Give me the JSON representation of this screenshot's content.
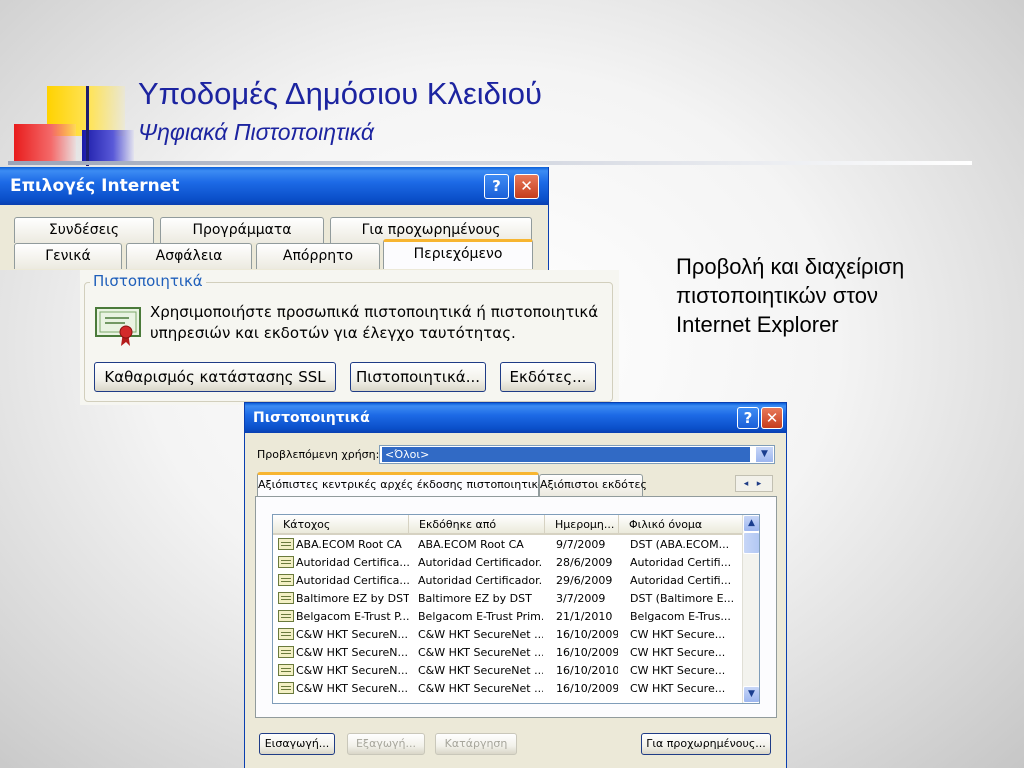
{
  "slide": {
    "title": "Υποδομές Δημόσιου Κλειδιού",
    "subtitle": "Ψηφιακά Πιστοποιητικά",
    "body_lines": [
      "Προβολή και διαχείριση",
      "πιστοποιητικών στον",
      "Internet Explorer"
    ]
  },
  "internet_options": {
    "title": "Επιλογές Internet",
    "help_glyph": "?",
    "close_glyph": "✕",
    "tabs_row1": [
      "Συνδέσεις",
      "Προγράμματα",
      "Για προχωρημένους"
    ],
    "tabs_row2": [
      "Γενικά",
      "Ασφάλεια",
      "Απόρρητο",
      "Περιεχόμενο"
    ],
    "active_tab": "Περιεχόμενο",
    "group_label": "Πιστοποιητικά",
    "description_lines": [
      "Χρησιμοποιήστε προσωπικά πιστοποιητικά ή πιστοποιητικά",
      "υπηρεσιών και εκδοτών για έλεγχο ταυτότητας."
    ],
    "buttons": {
      "clear_ssl": "Καθαρισμός κατάστασης SSL",
      "certificates": "Πιστοποιητικά...",
      "publishers": "Εκδότες..."
    }
  },
  "certificates": {
    "title": "Πιστοποιητικά",
    "help_glyph": "?",
    "close_glyph": "✕",
    "purpose_label": "Προβλεπόμενη χρήση:",
    "purpose_value": "<Όλοι>",
    "dropdown_glyph": "▼",
    "tabs": [
      "Αξιόπιστες κεντρικές αρχές έκδοσης πιστοποιητικών",
      "Αξιόπιστοι εκδότες"
    ],
    "tab_scroll_glyph": "◂ ▸",
    "columns": [
      "Κάτοχος",
      "Εκδόθηκε από",
      "Ημερομη...",
      "Φιλικό όνομα"
    ],
    "rows": [
      [
        "ABA.ECOM Root CA",
        "ABA.ECOM Root CA",
        "9/7/2009",
        "DST (ABA.ECOM..."
      ],
      [
        "Autoridad Certifica...",
        "Autoridad Certificador...",
        "28/6/2009",
        "Autoridad Certifi..."
      ],
      [
        "Autoridad Certifica...",
        "Autoridad Certificador...",
        "29/6/2009",
        "Autoridad Certifi..."
      ],
      [
        "Baltimore EZ by DST",
        "Baltimore EZ by DST",
        "3/7/2009",
        "DST (Baltimore E..."
      ],
      [
        "Belgacom E-Trust P...",
        "Belgacom E-Trust Prim...",
        "21/1/2010",
        "Belgacom E-Trus..."
      ],
      [
        "C&W HKT SecureN...",
        "C&W HKT SecureNet ...",
        "16/10/2009",
        "CW HKT Secure..."
      ],
      [
        "C&W HKT SecureN...",
        "C&W HKT SecureNet ...",
        "16/10/2009",
        "CW HKT Secure..."
      ],
      [
        "C&W HKT SecureN...",
        "C&W HKT SecureNet ...",
        "16/10/2010",
        "CW HKT Secure..."
      ],
      [
        "C&W HKT SecureN...",
        "C&W HKT SecureNet ...",
        "16/10/2009",
        "CW HKT Secure..."
      ]
    ],
    "scroll_up_glyph": "▲",
    "scroll_down_glyph": "▼",
    "buttons": {
      "import": "Εισαγωγή...",
      "export": "Εξαγωγή...",
      "remove": "Κατάργηση",
      "advanced": "Για προχωρημένους..."
    }
  }
}
